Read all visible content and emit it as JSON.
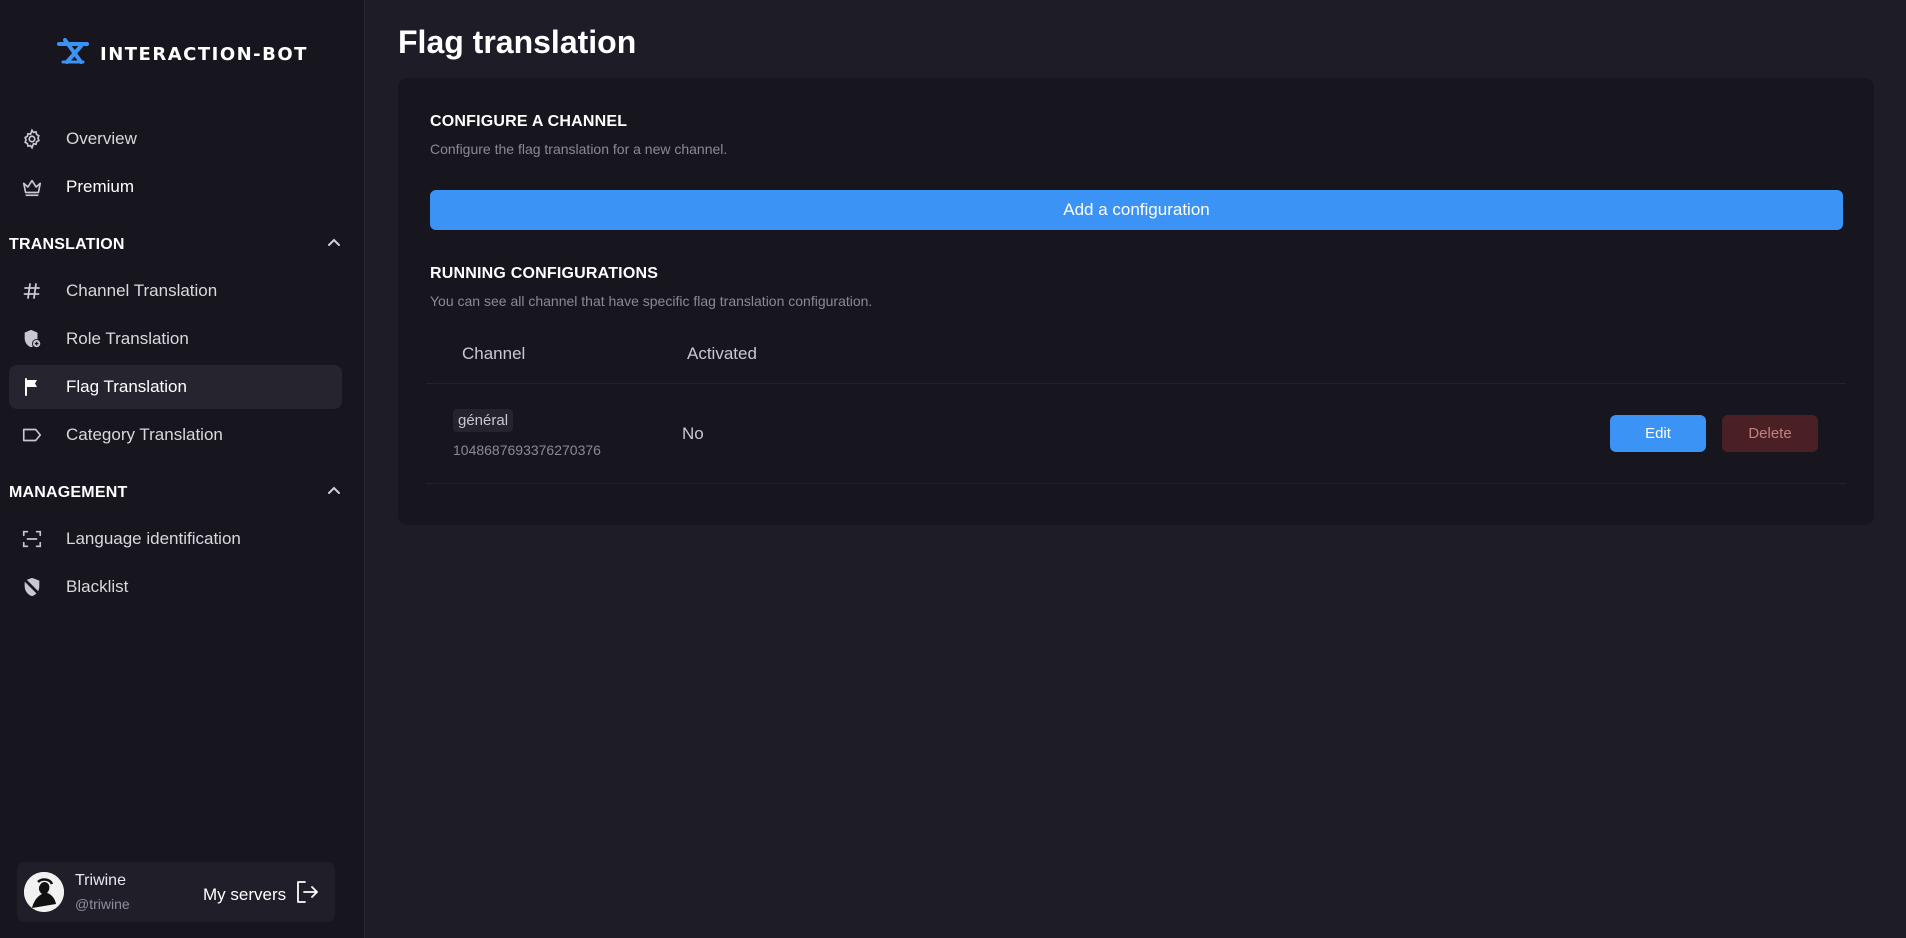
{
  "app": {
    "logo_text": "INTERACTION-BOT",
    "accent_color": "#3b93f5"
  },
  "sidebar": {
    "top_items": [
      {
        "label": "Overview",
        "icon": "gear-icon"
      },
      {
        "label": "Premium",
        "icon": "crown-icon"
      }
    ],
    "sections": [
      {
        "title": "TRANSLATION",
        "expanded": true,
        "items": [
          {
            "label": "Channel Translation",
            "icon": "hash-icon"
          },
          {
            "label": "Role Translation",
            "icon": "shield-plus-icon"
          },
          {
            "label": "Flag Translation",
            "icon": "flag-icon",
            "active": true
          },
          {
            "label": "Category Translation",
            "icon": "tag-icon"
          }
        ]
      },
      {
        "title": "MANAGEMENT",
        "expanded": true,
        "items": [
          {
            "label": "Language identification",
            "icon": "scan-icon"
          },
          {
            "label": "Blacklist",
            "icon": "shield-off-icon"
          }
        ]
      }
    ],
    "user": {
      "name": "Triwine",
      "handle": "@triwine",
      "my_servers_label": "My servers"
    }
  },
  "main": {
    "title": "Flag translation",
    "configure": {
      "heading": "CONFIGURE A CHANNEL",
      "description": "Configure the flag translation for a new channel.",
      "add_button_label": "Add a configuration"
    },
    "running": {
      "heading": "RUNNING CONFIGURATIONS",
      "description": "You can see all channel that have specific flag translation configuration.",
      "columns": [
        "Channel",
        "Activated"
      ],
      "rows": [
        {
          "channel_name": "général",
          "channel_id": "1048687693376270376",
          "activated": "No",
          "edit_label": "Edit",
          "delete_label": "Delete"
        }
      ]
    }
  }
}
